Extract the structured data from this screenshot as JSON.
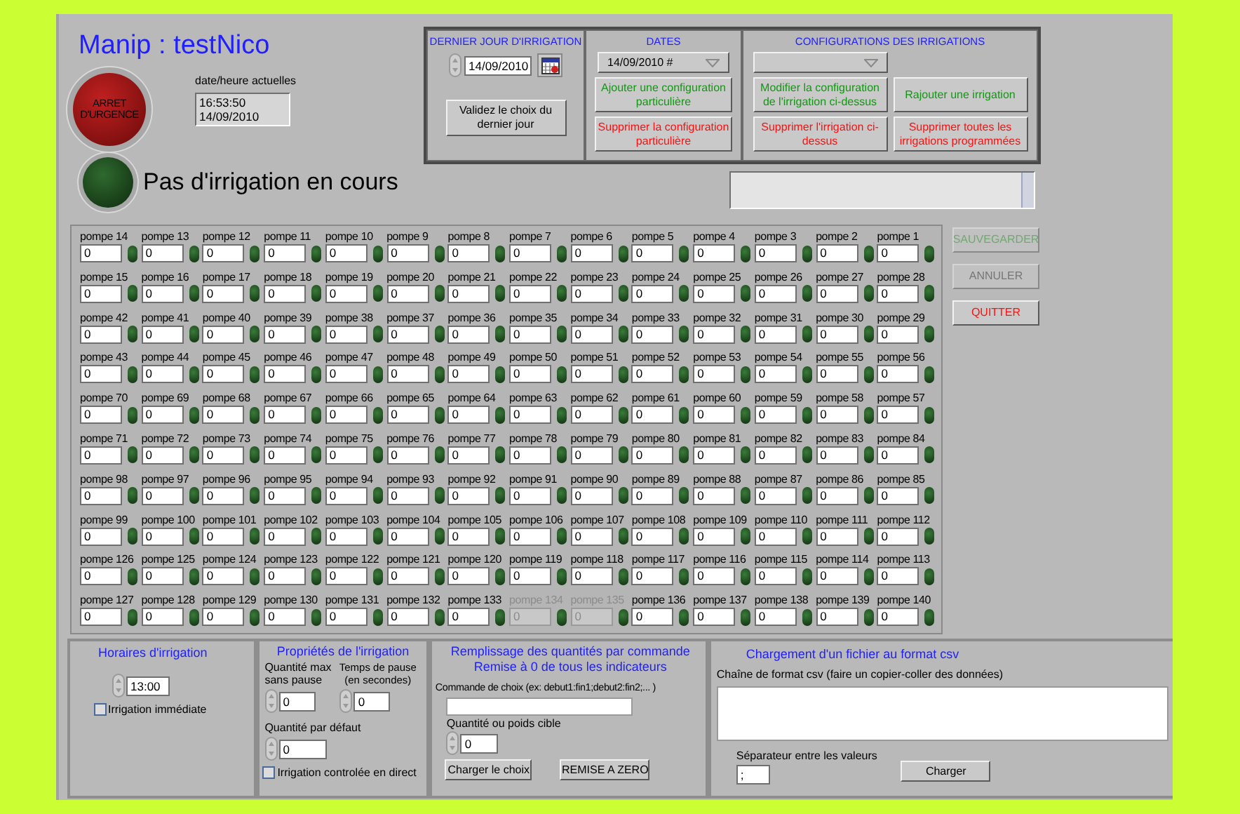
{
  "title": "Manip : testNico",
  "emergency_button": {
    "label": "ARRET D'URGENCE"
  },
  "clock": {
    "label": "date/heure actuelles",
    "time": "16:53:50",
    "date": "14/09/2010"
  },
  "status": {
    "on": false,
    "text": "Pas d'irrigation en cours"
  },
  "last_day": {
    "title": "DERNIER JOUR D'IRRIGATION",
    "date": "14/09/2010",
    "button": "Validez le choix du dernier jour"
  },
  "dates": {
    "title": "DATES",
    "selected_date": "14/09/2010 #",
    "buttons": [
      {
        "label": "Ajouter une configuration particulière",
        "kind": "add"
      },
      {
        "label": "Supprimer la configuration particulière",
        "kind": "delete"
      }
    ]
  },
  "configurations": {
    "title": "CONFIGURATIONS DES IRRIGATIONS",
    "buttons": [
      {
        "label": "Modifier la configuration de l'irrigation ci-dessus",
        "kind": "add"
      },
      {
        "label": "Rajouter une irrigation",
        "kind": "add"
      },
      {
        "label": "Supprimer l'irrigation ci-dessus",
        "kind": "delete"
      },
      {
        "label": "Supprimer toutes les irrigations programmées",
        "kind": "delete"
      }
    ]
  },
  "pump_rows": [
    {
      "pumps": [
        {
          "label": "pompe 14",
          "value": "0",
          "lit": false,
          "disabled": false
        },
        {
          "label": "pompe 13",
          "value": "0",
          "lit": false,
          "disabled": false
        },
        {
          "label": "pompe 12",
          "value": "0",
          "lit": false,
          "disabled": false
        },
        {
          "label": "pompe 11",
          "value": "0",
          "lit": false,
          "disabled": false
        },
        {
          "label": "pompe 10",
          "value": "0",
          "lit": false,
          "disabled": false
        },
        {
          "label": "pompe 9",
          "value": "0",
          "lit": false,
          "disabled": false
        },
        {
          "label": "pompe 8",
          "value": "0",
          "lit": false,
          "disabled": false
        },
        {
          "label": "pompe 7",
          "value": "0",
          "lit": false,
          "disabled": false
        },
        {
          "label": "pompe 6",
          "value": "0",
          "lit": false,
          "disabled": false
        },
        {
          "label": "pompe 5",
          "value": "0",
          "lit": false,
          "disabled": false
        },
        {
          "label": "pompe 4",
          "value": "0",
          "lit": false,
          "disabled": false
        },
        {
          "label": "pompe 3",
          "value": "0",
          "lit": false,
          "disabled": false
        },
        {
          "label": "pompe 2",
          "value": "0",
          "lit": false,
          "disabled": false
        },
        {
          "label": "pompe 1",
          "value": "0",
          "lit": false,
          "disabled": false
        }
      ]
    },
    {
      "pumps": [
        {
          "label": "pompe 15",
          "value": "0",
          "lit": false,
          "disabled": false
        },
        {
          "label": "pompe 16",
          "value": "0",
          "lit": false,
          "disabled": false
        },
        {
          "label": "pompe 17",
          "value": "0",
          "lit": false,
          "disabled": false
        },
        {
          "label": "pompe 18",
          "value": "0",
          "lit": false,
          "disabled": false
        },
        {
          "label": "pompe 19",
          "value": "0",
          "lit": false,
          "disabled": false
        },
        {
          "label": "pompe 20",
          "value": "0",
          "lit": false,
          "disabled": false
        },
        {
          "label": "pompe 21",
          "value": "0",
          "lit": false,
          "disabled": false
        },
        {
          "label": "pompe 22",
          "value": "0",
          "lit": false,
          "disabled": false
        },
        {
          "label": "pompe 23",
          "value": "0",
          "lit": false,
          "disabled": false
        },
        {
          "label": "pompe 24",
          "value": "0",
          "lit": false,
          "disabled": false
        },
        {
          "label": "pompe 25",
          "value": "0",
          "lit": false,
          "disabled": false
        },
        {
          "label": "pompe 26",
          "value": "0",
          "lit": false,
          "disabled": false
        },
        {
          "label": "pompe 27",
          "value": "0",
          "lit": false,
          "disabled": false
        },
        {
          "label": "pompe 28",
          "value": "0",
          "lit": false,
          "disabled": false
        }
      ]
    },
    {
      "pumps": [
        {
          "label": "pompe 42",
          "value": "0",
          "lit": false,
          "disabled": false
        },
        {
          "label": "pompe 41",
          "value": "0",
          "lit": false,
          "disabled": false
        },
        {
          "label": "pompe 40",
          "value": "0",
          "lit": false,
          "disabled": false
        },
        {
          "label": "pompe 39",
          "value": "0",
          "lit": false,
          "disabled": false
        },
        {
          "label": "pompe 38",
          "value": "0",
          "lit": false,
          "disabled": false
        },
        {
          "label": "pompe 37",
          "value": "0",
          "lit": false,
          "disabled": false
        },
        {
          "label": "pompe 36",
          "value": "0",
          "lit": false,
          "disabled": false
        },
        {
          "label": "pompe 35",
          "value": "0",
          "lit": false,
          "disabled": false
        },
        {
          "label": "pompe 34",
          "value": "0",
          "lit": false,
          "disabled": false
        },
        {
          "label": "pompe 33",
          "value": "0",
          "lit": false,
          "disabled": false
        },
        {
          "label": "pompe 32",
          "value": "0",
          "lit": false,
          "disabled": false
        },
        {
          "label": "pompe 31",
          "value": "0",
          "lit": false,
          "disabled": false
        },
        {
          "label": "pompe 30",
          "value": "0",
          "lit": false,
          "disabled": false
        },
        {
          "label": "pompe 29",
          "value": "0",
          "lit": false,
          "disabled": false
        }
      ]
    },
    {
      "pumps": [
        {
          "label": "pompe 43",
          "value": "0",
          "lit": false,
          "disabled": false
        },
        {
          "label": "pompe 44",
          "value": "0",
          "lit": false,
          "disabled": false
        },
        {
          "label": "pompe 45",
          "value": "0",
          "lit": false,
          "disabled": false
        },
        {
          "label": "pompe 46",
          "value": "0",
          "lit": false,
          "disabled": false
        },
        {
          "label": "pompe 47",
          "value": "0",
          "lit": false,
          "disabled": false
        },
        {
          "label": "pompe 48",
          "value": "0",
          "lit": false,
          "disabled": false
        },
        {
          "label": "pompe 49",
          "value": "0",
          "lit": false,
          "disabled": false
        },
        {
          "label": "pompe 50",
          "value": "0",
          "lit": false,
          "disabled": false
        },
        {
          "label": "pompe 51",
          "value": "0",
          "lit": false,
          "disabled": false
        },
        {
          "label": "pompe 52",
          "value": "0",
          "lit": false,
          "disabled": false
        },
        {
          "label": "pompe 53",
          "value": "0",
          "lit": false,
          "disabled": false
        },
        {
          "label": "pompe 54",
          "value": "0",
          "lit": false,
          "disabled": false
        },
        {
          "label": "pompe 55",
          "value": "0",
          "lit": false,
          "disabled": false
        },
        {
          "label": "pompe 56",
          "value": "0",
          "lit": false,
          "disabled": false
        }
      ]
    },
    {
      "pumps": [
        {
          "label": "pompe 70",
          "value": "0",
          "lit": false,
          "disabled": false
        },
        {
          "label": "pompe 69",
          "value": "0",
          "lit": false,
          "disabled": false
        },
        {
          "label": "pompe 68",
          "value": "0",
          "lit": false,
          "disabled": false
        },
        {
          "label": "pompe 67",
          "value": "0",
          "lit": false,
          "disabled": false
        },
        {
          "label": "pompe 66",
          "value": "0",
          "lit": false,
          "disabled": false
        },
        {
          "label": "pompe 65",
          "value": "0",
          "lit": false,
          "disabled": false
        },
        {
          "label": "pompe 64",
          "value": "0",
          "lit": false,
          "disabled": false
        },
        {
          "label": "pompe 63",
          "value": "0",
          "lit": false,
          "disabled": false
        },
        {
          "label": "pompe 62",
          "value": "0",
          "lit": false,
          "disabled": false
        },
        {
          "label": "pompe 61",
          "value": "0",
          "lit": false,
          "disabled": false
        },
        {
          "label": "pompe 60",
          "value": "0",
          "lit": false,
          "disabled": false
        },
        {
          "label": "pompe 59",
          "value": "0",
          "lit": false,
          "disabled": false
        },
        {
          "label": "pompe 58",
          "value": "0",
          "lit": false,
          "disabled": false
        },
        {
          "label": "pompe 57",
          "value": "0",
          "lit": false,
          "disabled": false
        }
      ]
    },
    {
      "pumps": [
        {
          "label": "pompe 71",
          "value": "0",
          "lit": false,
          "disabled": false
        },
        {
          "label": "pompe 72",
          "value": "0",
          "lit": false,
          "disabled": false
        },
        {
          "label": "pompe 73",
          "value": "0",
          "lit": false,
          "disabled": false
        },
        {
          "label": "pompe 74",
          "value": "0",
          "lit": false,
          "disabled": false
        },
        {
          "label": "pompe 75",
          "value": "0",
          "lit": false,
          "disabled": false
        },
        {
          "label": "pompe 76",
          "value": "0",
          "lit": false,
          "disabled": false
        },
        {
          "label": "pompe 77",
          "value": "0",
          "lit": false,
          "disabled": false
        },
        {
          "label": "pompe 78",
          "value": "0",
          "lit": false,
          "disabled": false
        },
        {
          "label": "pompe 79",
          "value": "0",
          "lit": false,
          "disabled": false
        },
        {
          "label": "pompe 80",
          "value": "0",
          "lit": false,
          "disabled": false
        },
        {
          "label": "pompe 81",
          "value": "0",
          "lit": false,
          "disabled": false
        },
        {
          "label": "pompe 82",
          "value": "0",
          "lit": false,
          "disabled": false
        },
        {
          "label": "pompe 83",
          "value": "0",
          "lit": false,
          "disabled": false
        },
        {
          "label": "pompe 84",
          "value": "0",
          "lit": false,
          "disabled": false
        }
      ]
    },
    {
      "pumps": [
        {
          "label": "pompe 98",
          "value": "0",
          "lit": false,
          "disabled": false
        },
        {
          "label": "pompe 97",
          "value": "0",
          "lit": false,
          "disabled": false
        },
        {
          "label": "pompe 96",
          "value": "0",
          "lit": false,
          "disabled": false
        },
        {
          "label": "pompe 95",
          "value": "0",
          "lit": false,
          "disabled": false
        },
        {
          "label": "pompe 94",
          "value": "0",
          "lit": false,
          "disabled": false
        },
        {
          "label": "pompe 93",
          "value": "0",
          "lit": false,
          "disabled": false
        },
        {
          "label": "pompe 92",
          "value": "0",
          "lit": false,
          "disabled": false
        },
        {
          "label": "pompe 91",
          "value": "0",
          "lit": false,
          "disabled": false
        },
        {
          "label": "pompe 90",
          "value": "0",
          "lit": false,
          "disabled": false
        },
        {
          "label": "pompe 89",
          "value": "0",
          "lit": false,
          "disabled": false
        },
        {
          "label": "pompe 88",
          "value": "0",
          "lit": false,
          "disabled": false
        },
        {
          "label": "pompe 87",
          "value": "0",
          "lit": false,
          "disabled": false
        },
        {
          "label": "pompe 86",
          "value": "0",
          "lit": false,
          "disabled": false
        },
        {
          "label": "pompe 85",
          "value": "0",
          "lit": false,
          "disabled": false
        }
      ]
    },
    {
      "pumps": [
        {
          "label": "pompe 99",
          "value": "0",
          "lit": false,
          "disabled": false
        },
        {
          "label": "pompe 100",
          "value": "0",
          "lit": false,
          "disabled": false
        },
        {
          "label": "pompe 101",
          "value": "0",
          "lit": false,
          "disabled": false
        },
        {
          "label": "pompe 102",
          "value": "0",
          "lit": false,
          "disabled": false
        },
        {
          "label": "pompe 103",
          "value": "0",
          "lit": false,
          "disabled": false
        },
        {
          "label": "pompe 104",
          "value": "0",
          "lit": false,
          "disabled": false
        },
        {
          "label": "pompe 105",
          "value": "0",
          "lit": false,
          "disabled": false
        },
        {
          "label": "pompe 106",
          "value": "0",
          "lit": false,
          "disabled": false
        },
        {
          "label": "pompe 107",
          "value": "0",
          "lit": false,
          "disabled": false
        },
        {
          "label": "pompe 108",
          "value": "0",
          "lit": false,
          "disabled": false
        },
        {
          "label": "pompe 109",
          "value": "0",
          "lit": false,
          "disabled": false
        },
        {
          "label": "pompe 110",
          "value": "0",
          "lit": false,
          "disabled": false
        },
        {
          "label": "pompe 111",
          "value": "0",
          "lit": false,
          "disabled": false
        },
        {
          "label": "pompe 112",
          "value": "0",
          "lit": false,
          "disabled": false
        }
      ]
    },
    {
      "pumps": [
        {
          "label": "pompe 126",
          "value": "0",
          "lit": false,
          "disabled": false
        },
        {
          "label": "pompe 125",
          "value": "0",
          "lit": false,
          "disabled": false
        },
        {
          "label": "pompe 124",
          "value": "0",
          "lit": false,
          "disabled": false
        },
        {
          "label": "pompe 123",
          "value": "0",
          "lit": false,
          "disabled": false
        },
        {
          "label": "pompe 122",
          "value": "0",
          "lit": false,
          "disabled": false
        },
        {
          "label": "pompe 121",
          "value": "0",
          "lit": false,
          "disabled": false
        },
        {
          "label": "pompe 120",
          "value": "0",
          "lit": false,
          "disabled": false
        },
        {
          "label": "pompe 119",
          "value": "0",
          "lit": false,
          "disabled": false
        },
        {
          "label": "pompe 118",
          "value": "0",
          "lit": false,
          "disabled": false
        },
        {
          "label": "pompe 117",
          "value": "0",
          "lit": false,
          "disabled": false
        },
        {
          "label": "pompe 116",
          "value": "0",
          "lit": false,
          "disabled": false
        },
        {
          "label": "pompe 115",
          "value": "0",
          "lit": false,
          "disabled": false
        },
        {
          "label": "pompe 114",
          "value": "0",
          "lit": false,
          "disabled": false
        },
        {
          "label": "pompe 113",
          "value": "0",
          "lit": false,
          "disabled": false
        }
      ]
    },
    {
      "pumps": [
        {
          "label": "pompe 127",
          "value": "0",
          "lit": false,
          "disabled": false
        },
        {
          "label": "pompe 128",
          "value": "0",
          "lit": false,
          "disabled": false
        },
        {
          "label": "pompe 129",
          "value": "0",
          "lit": false,
          "disabled": false
        },
        {
          "label": "pompe 130",
          "value": "0",
          "lit": false,
          "disabled": false
        },
        {
          "label": "pompe 131",
          "value": "0",
          "lit": false,
          "disabled": false
        },
        {
          "label": "pompe 132",
          "value": "0",
          "lit": false,
          "disabled": false
        },
        {
          "label": "pompe 133",
          "value": "0",
          "lit": false,
          "disabled": false
        },
        {
          "label": "pompe 134",
          "value": "0",
          "lit": false,
          "disabled": true
        },
        {
          "label": "pompe 135",
          "value": "0",
          "lit": false,
          "disabled": true
        },
        {
          "label": "pompe 136",
          "value": "0",
          "lit": false,
          "disabled": false
        },
        {
          "label": "pompe 137",
          "value": "0",
          "lit": false,
          "disabled": false
        },
        {
          "label": "pompe 138",
          "value": "0",
          "lit": false,
          "disabled": false
        },
        {
          "label": "pompe 139",
          "value": "0",
          "lit": false,
          "disabled": false
        },
        {
          "label": "pompe 140",
          "value": "0",
          "lit": false,
          "disabled": false
        }
      ]
    }
  ],
  "side_buttons": [
    {
      "label": "SAUVEGARDER",
      "kind": "save",
      "disabled": true
    },
    {
      "label": "ANNULER",
      "kind": "cancel",
      "disabled": true
    },
    {
      "label": "QUITTER",
      "kind": "quit",
      "disabled": false
    }
  ],
  "schedule": {
    "title": "Horaires d'irrigation",
    "time": "13:00",
    "immediate": {
      "label": "Irrigation immédiate",
      "checked": false
    }
  },
  "properties": {
    "title": "Propriétés de l'irrigation",
    "max_label": "Quantité max sans pause",
    "max_value": "0",
    "pause_label": "Temps de pause (en secondes)",
    "pause_value": "0",
    "default_label": "Quantité par défaut",
    "default_value": "0",
    "direct": {
      "label": "Irrigation controlée en direct",
      "checked": false
    }
  },
  "command": {
    "title_lines": [
      "Remplissage des quantités  par commande",
      "Remise à 0 de tous les indicateurs"
    ],
    "choice_label": "Commande de choix (ex:  debut1:fin1;debut2:fin2;... )",
    "target_label": "Quantité ou poids cible",
    "target_value": "0",
    "load_button": "Charger le choix",
    "reset_button": "REMISE A ZERO"
  },
  "csv": {
    "title": "Chargement d'un fichier au format csv",
    "format_label": "Chaîne de format csv (faire un copier-coller des données)",
    "separator_label": "Séparateur entre les valeurs",
    "separator": ";",
    "load_button": "Charger"
  }
}
